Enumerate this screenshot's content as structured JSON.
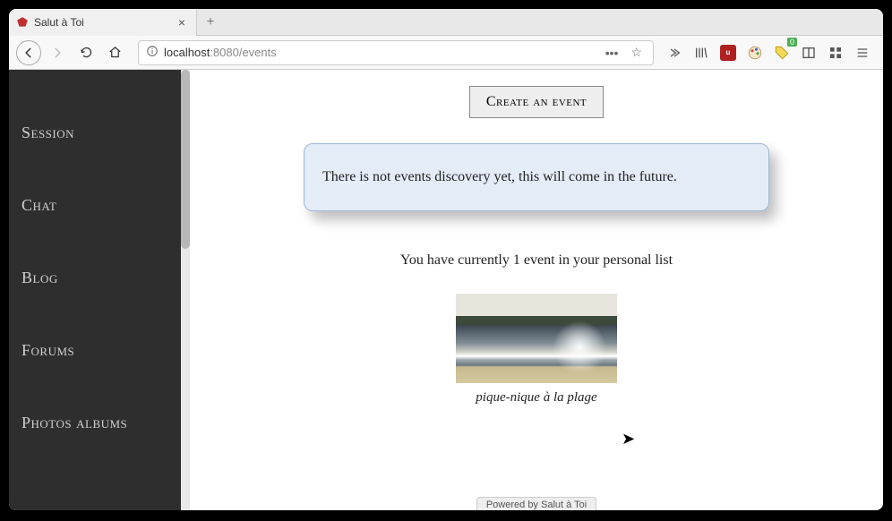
{
  "tab": {
    "title": "Salut à Toi"
  },
  "url": {
    "host": "localhost",
    "rest": ":8080/events"
  },
  "toolbar_badge": "0",
  "sidebar": {
    "items": [
      {
        "label": "Session"
      },
      {
        "label": "Chat"
      },
      {
        "label": "Blog"
      },
      {
        "label": "Forums"
      },
      {
        "label": "Photos albums"
      }
    ]
  },
  "main": {
    "create_label": "Create an event",
    "notice": "There is not events discovery yet, this will come in the future.",
    "list_intro": "You have currently 1 event in your personal list",
    "event": {
      "title": "pique-nique à la plage"
    },
    "footer": "Powered by Salut à Toi"
  }
}
